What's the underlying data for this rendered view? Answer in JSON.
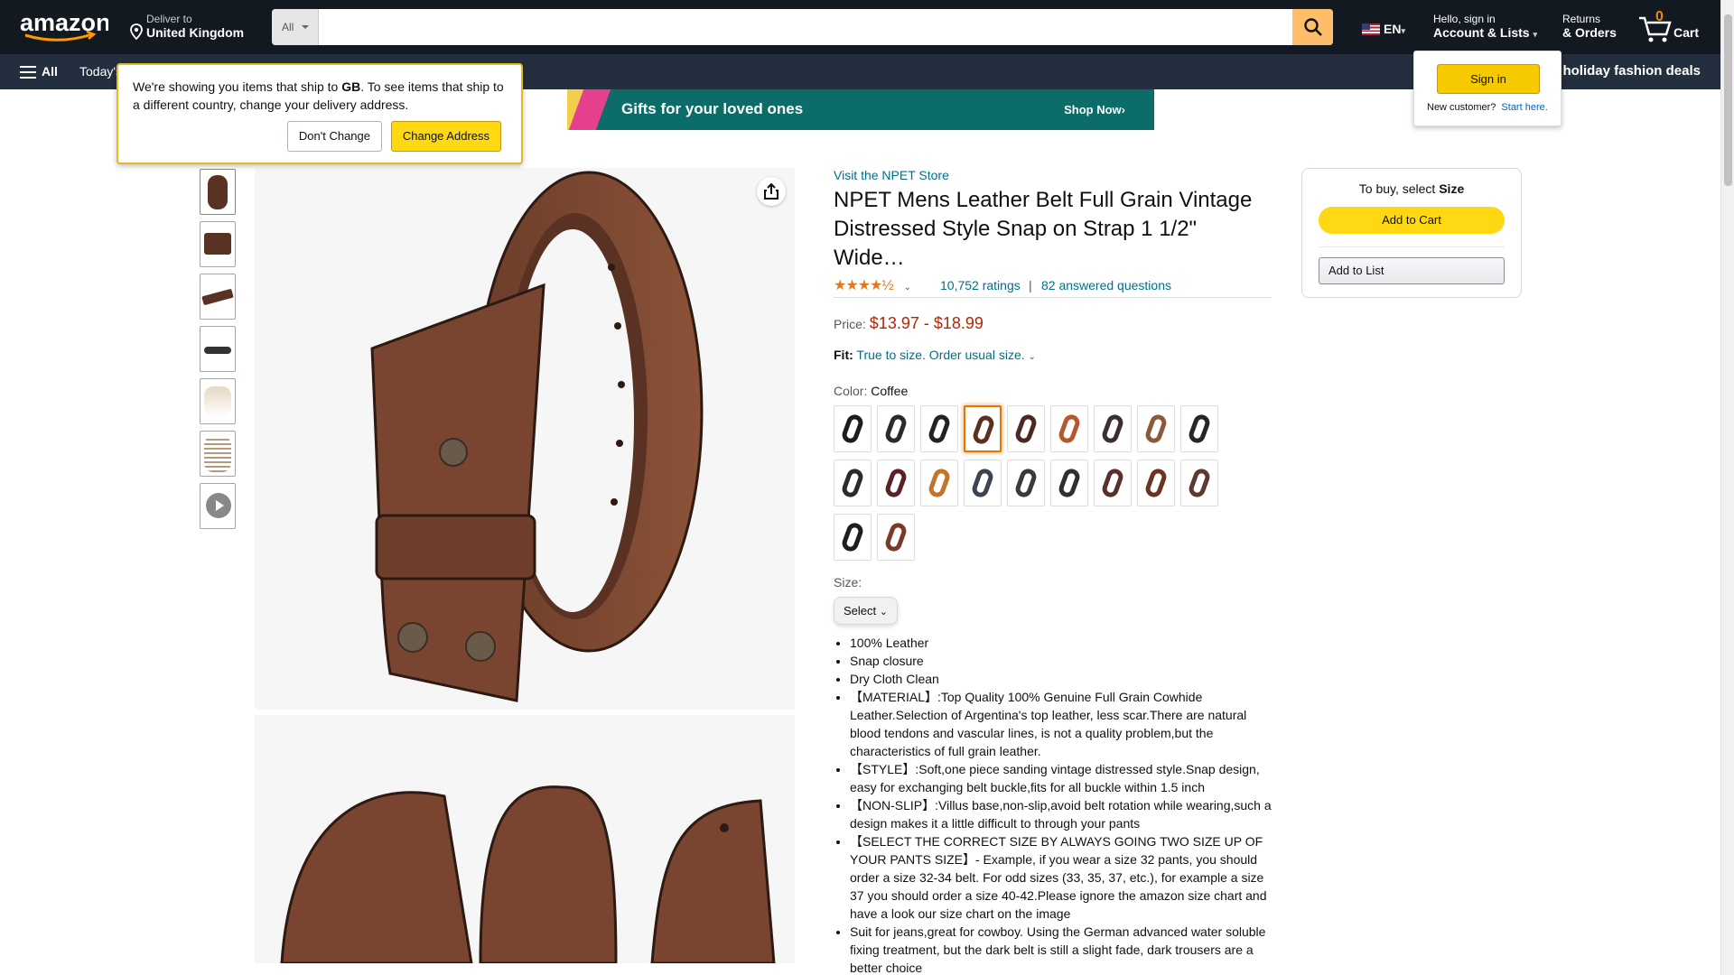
{
  "header": {
    "deliver_line1": "Deliver to",
    "deliver_line2": "United Kingdom",
    "search_category": "All",
    "search_value": "",
    "language": "EN",
    "account_line1": "Hello, sign in",
    "account_line2": "Account & Lists",
    "returns_line1": "Returns",
    "returns_line2": "& Orders",
    "cart_count": "0",
    "cart_label": "Cart"
  },
  "nav": {
    "all_label": "All",
    "today_label": "Today's",
    "promo_label": "p holiday fashion deals"
  },
  "banner": {
    "text": "Gifts for your loved ones",
    "cta": "Shop Now›"
  },
  "ship_popover": {
    "text_a": "We're showing you items that ship to ",
    "country": "GB",
    "text_b": ". To see items that ship to a different country, change your delivery address.",
    "dont_change": "Don't Change",
    "change_address": "Change Address"
  },
  "signin_popover": {
    "sign_in": "Sign in",
    "new_customer": "New customer?",
    "start_here": "Start here."
  },
  "product": {
    "store_link": "Visit the NPET Store",
    "title": "NPET Mens Leather Belt Full Grain Vintage Distressed Style Snap on Strap 1 1/2\" Wide…",
    "stars": "★★★★½",
    "rating_value": 4.5,
    "ratings": "10,752 ratings",
    "separator": "|",
    "answered": "82 answered questions",
    "price_label": "Price:",
    "price": "$13.97 - $18.99",
    "fit_label": "Fit:",
    "fit_value": "True to size. Order usual size.",
    "color_label": "Color: ",
    "color_value": "Coffee",
    "size_label": "Size:",
    "size_select": "Select",
    "bullets": [
      "100% Leather",
      "Snap closure",
      "Dry Cloth Clean",
      "【MATERIAL】:Top Quality 100% Genuine Full Grain Cowhide Leather.Selection of Argentina's top leather, less scar.There are natural blood tendons and vascular lines, is not a quality problem,but the characteristics of full grain leather.",
      "【STYLE】:Soft,one piece sanding vintage distressed style.Snap design, easy for exchanging belt buckle,fits for all buckle within 1.5 inch",
      "【NON-SLIP】:Villus base,non-slip,avoid belt rotation while wearing,such a design makes it a little difficult to through your pants",
      "【SELECT THE CORRECT SIZE BY ALWAYS GOING TWO SIZE UP OF YOUR PANTS SIZE】- Example, if you wear a size 32 pants, you should order a size 32-34 belt. For odd sizes (33, 35, 37, etc.), for example a size 37 you should order a size 40-42.Please ignore the amazon size chart and have a look our size chart on the image",
      "Suit for jeans,great for cowboy. Using the German advanced water soluble fixing treatment, but the dark belt is still a slight fade, dark trousers are a better choice"
    ],
    "swatch_colors": [
      "#1c1c1c",
      "#2a2a2a",
      "#222222",
      "#5a3020",
      "#4a2a20",
      "#b5582e",
      "#3a2e30",
      "#8a5a3a",
      "#262626",
      "#2b2b2b",
      "#5a2224",
      "#c2752a",
      "#3b4450",
      "#3a3a3a",
      "#303030",
      "#5b2f2c",
      "#6b3422",
      "#5c3a32",
      "#1e1e1e",
      "#7a3a2a"
    ],
    "swatch_selected": 3
  },
  "buybox": {
    "to_buy": "To buy, select ",
    "to_buy_bold": "Size",
    "add_to_cart": "Add to Cart",
    "add_to_list": "Add to List"
  }
}
